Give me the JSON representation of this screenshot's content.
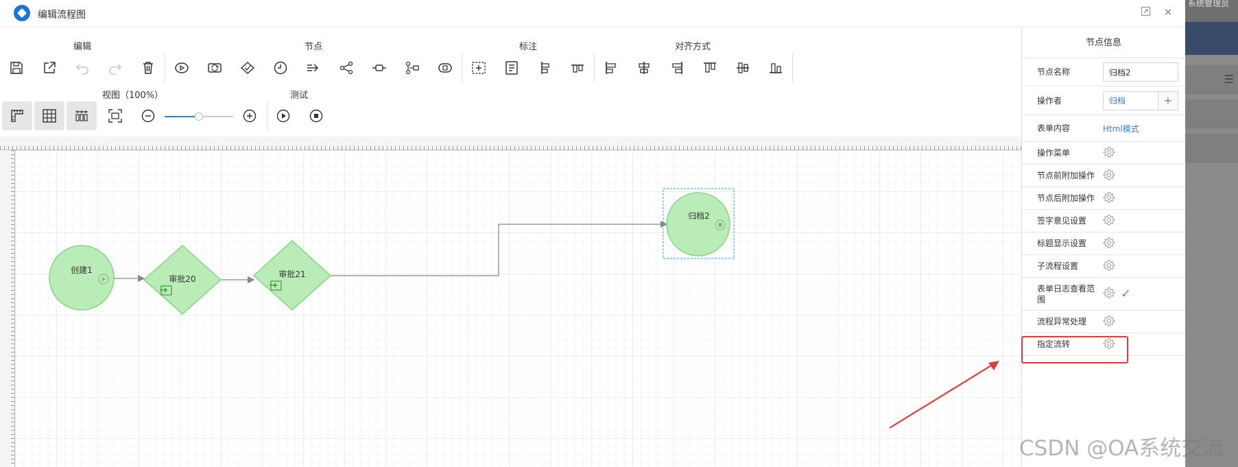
{
  "backdrop": {
    "header_text": "系统管理员"
  },
  "window": {
    "title": "编辑流程图"
  },
  "toolbar": {
    "groups": {
      "edit": "编辑",
      "node": "节点",
      "annotate": "标注",
      "align": "对齐方式",
      "view": "视图（100%）",
      "test": "测试"
    },
    "zoom_percent": 100
  },
  "flow": {
    "nodes": [
      {
        "id": "create1",
        "label": "创建1",
        "type": "start"
      },
      {
        "id": "approve20",
        "label": "审批20",
        "type": "approval"
      },
      {
        "id": "approve21",
        "label": "审批21",
        "type": "approval"
      },
      {
        "id": "archive2",
        "label": "归档2",
        "type": "end",
        "selected": true
      }
    ],
    "node_fill": "#b9ecb6",
    "node_stroke": "#7ccf7a"
  },
  "panel": {
    "title": "节点信息",
    "node_name_label": "节点名称",
    "node_name_value": "归档2",
    "operator_label": "操作者",
    "operator_value": "归档",
    "operator_add": "+",
    "form_content_label": "表单内容",
    "form_content_link": "Html模式",
    "rows": [
      {
        "label": "操作菜单",
        "checked": false
      },
      {
        "label": "节点前附加操作",
        "checked": false
      },
      {
        "label": "节点后附加操作",
        "checked": false
      },
      {
        "label": "签字意见设置",
        "checked": false
      },
      {
        "label": "标题显示设置",
        "checked": false
      },
      {
        "label": "子流程设置",
        "checked": false
      },
      {
        "label": "表单日志查看范围",
        "checked": true
      },
      {
        "label": "流程异常处理",
        "checked": false,
        "highlighted": true
      },
      {
        "label": "指定流转",
        "checked": false
      }
    ],
    "check_glyph": "✓"
  },
  "watermark": "CSDN @OA系统交流",
  "accent_color": "#1e73d9",
  "highlight_color": "#e53935"
}
